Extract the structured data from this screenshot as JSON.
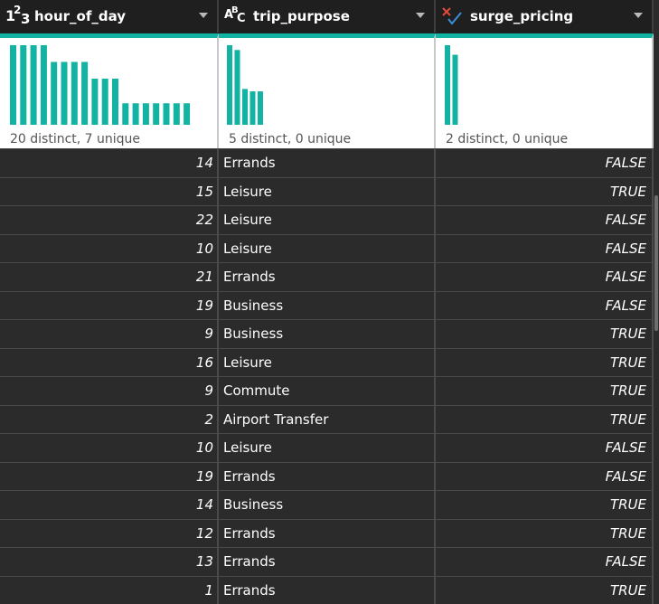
{
  "columns": [
    {
      "name": "hour_of_day",
      "type_icon": "whole-number-icon",
      "type_glyph_main": "1",
      "type_glyph_sup": "2",
      "type_glyph_sub": "3",
      "stats": "20 distinct, 7 unique"
    },
    {
      "name": "trip_purpose",
      "type_icon": "text-type-icon",
      "type_glyph_main": "A",
      "type_glyph_sup": "B",
      "type_glyph_sub": "C",
      "stats": "5 distinct, 0 unique"
    },
    {
      "name": "surge_pricing",
      "type_icon": "boolean-type-icon",
      "stats": "2 distinct, 0 unique"
    }
  ],
  "distributions": {
    "hour_of_day": [
      1.0,
      1.0,
      1.0,
      1.0,
      0.79,
      0.79,
      0.79,
      0.79,
      0.58,
      0.58,
      0.58,
      0.27,
      0.27,
      0.27,
      0.27,
      0.27,
      0.27,
      0.27
    ],
    "trip_purpose": [
      1.0,
      0.94,
      0.45,
      0.42,
      0.42
    ],
    "surge_pricing": [
      1.0,
      0.88
    ]
  },
  "rows": [
    {
      "hour": "14",
      "purpose": "Errands",
      "surge": "FALSE"
    },
    {
      "hour": "15",
      "purpose": "Leisure",
      "surge": "TRUE"
    },
    {
      "hour": "22",
      "purpose": "Leisure",
      "surge": "FALSE"
    },
    {
      "hour": "10",
      "purpose": "Leisure",
      "surge": "FALSE"
    },
    {
      "hour": "21",
      "purpose": "Errands",
      "surge": "FALSE"
    },
    {
      "hour": "19",
      "purpose": "Business",
      "surge": "FALSE"
    },
    {
      "hour": "9",
      "purpose": "Business",
      "surge": "TRUE"
    },
    {
      "hour": "16",
      "purpose": "Leisure",
      "surge": "TRUE"
    },
    {
      "hour": "9",
      "purpose": "Commute",
      "surge": "TRUE"
    },
    {
      "hour": "2",
      "purpose": "Airport Transfer",
      "surge": "TRUE"
    },
    {
      "hour": "10",
      "purpose": "Leisure",
      "surge": "FALSE"
    },
    {
      "hour": "19",
      "purpose": "Errands",
      "surge": "FALSE"
    },
    {
      "hour": "14",
      "purpose": "Business",
      "surge": "TRUE"
    },
    {
      "hour": "12",
      "purpose": "Errands",
      "surge": "TRUE"
    },
    {
      "hour": "13",
      "purpose": "Errands",
      "surge": "FALSE"
    },
    {
      "hour": "1",
      "purpose": "Errands",
      "surge": "TRUE"
    }
  ],
  "colors": {
    "bar": "#12b3a2",
    "header_bg": "#1f1f1f",
    "grid_bg": "#2b2b2b",
    "boolean_x": "#e04a3a",
    "boolean_check": "#3a8fd6"
  }
}
